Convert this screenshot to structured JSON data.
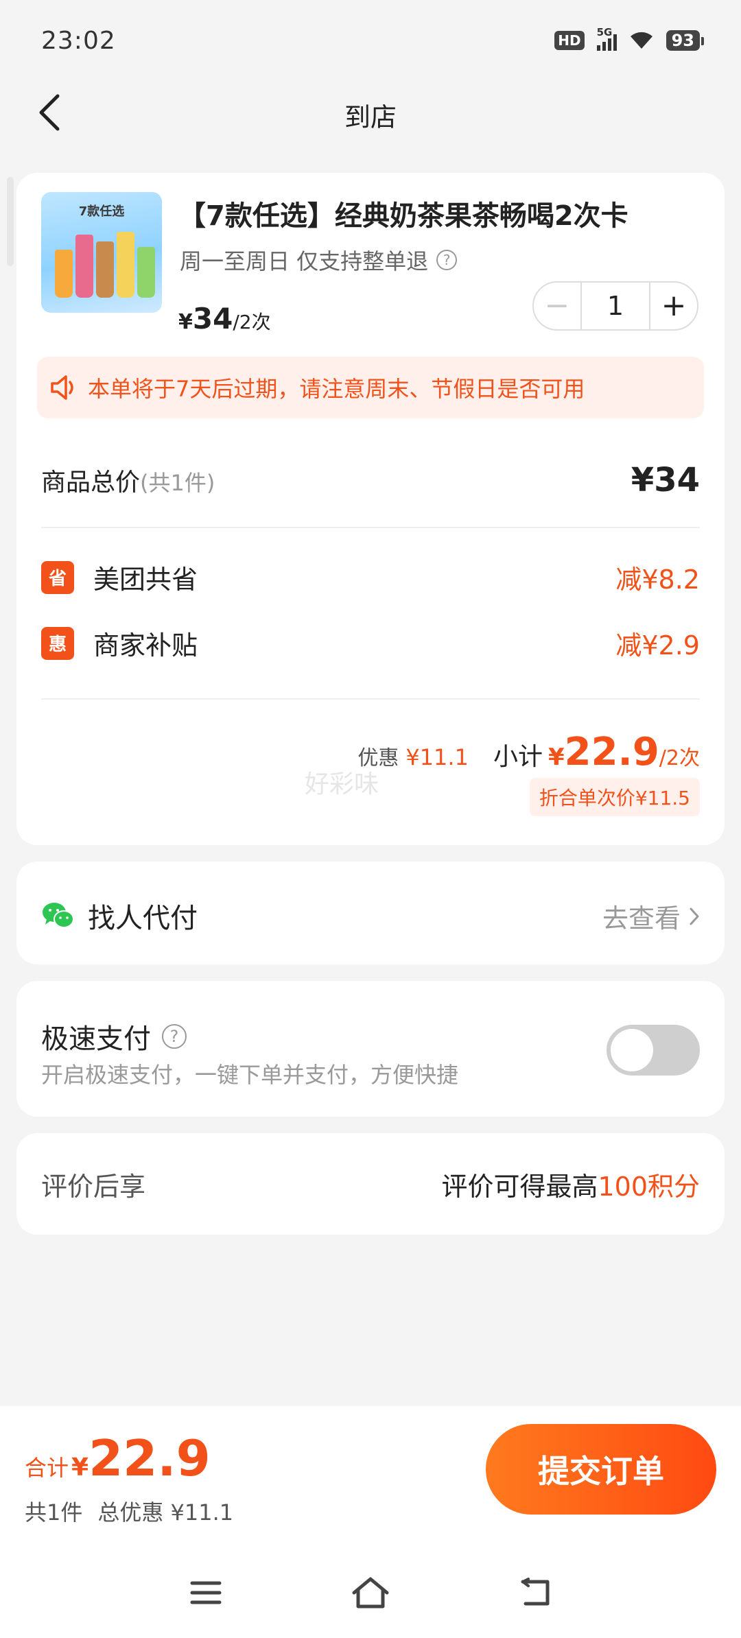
{
  "status_bar": {
    "time": "23:02",
    "hd": "HD",
    "network": "5G",
    "battery": "93"
  },
  "nav": {
    "title": "到店"
  },
  "product": {
    "image_caption": "7款任选",
    "title": "【7款任选】经典奶茶果茶畅喝2次卡",
    "subtitle": "周一至周日 仅支持整单退",
    "help_symbol": "?",
    "price_currency": "¥",
    "price": "34",
    "price_unit": "/2次",
    "quantity": "1",
    "minus_symbol": "−",
    "plus_symbol": "+"
  },
  "notice": {
    "text": "本单将于7天后过期，请注意周末、节假日是否可用"
  },
  "total": {
    "label": "商品总价",
    "count": "(共1件)",
    "value": "¥34"
  },
  "discounts": [
    {
      "badge": "省",
      "label": "美团共省",
      "value": "减¥8.2"
    },
    {
      "badge": "惠",
      "label": "商家补贴",
      "value": "减¥2.9"
    }
  ],
  "subtotal": {
    "discount_label": "优惠",
    "discount_value": "¥11.1",
    "label": "小计",
    "currency": "¥",
    "value": "22.9",
    "unit": "/2次",
    "per_use": "折合单次价¥11.5"
  },
  "watermark": "好彩味",
  "friend_pay": {
    "label": "找人代付",
    "action": "去查看"
  },
  "fast_pay": {
    "title": "极速支付",
    "help_symbol": "?",
    "subtitle": "开启极速支付，一键下单并支付，方便快捷",
    "enabled": false
  },
  "review": {
    "label": "评价后享",
    "text": "评价可得最高",
    "highlight": "100积分"
  },
  "bottom": {
    "total_label": "合计",
    "currency": "¥",
    "total_value": "22.9",
    "count": "共1件",
    "discount": "总优惠 ¥11.1",
    "submit_label": "提交订单"
  },
  "colors": {
    "accent": "#f2521a",
    "background": "#f4f4f4",
    "notice_bg": "#fff0ec",
    "wechat_green": "#2dc653"
  },
  "icons": [
    "back-icon",
    "help-icon",
    "speaker-icon",
    "wechat-icon",
    "chevron-right-icon",
    "menu-icon",
    "home-icon",
    "return-icon"
  ]
}
